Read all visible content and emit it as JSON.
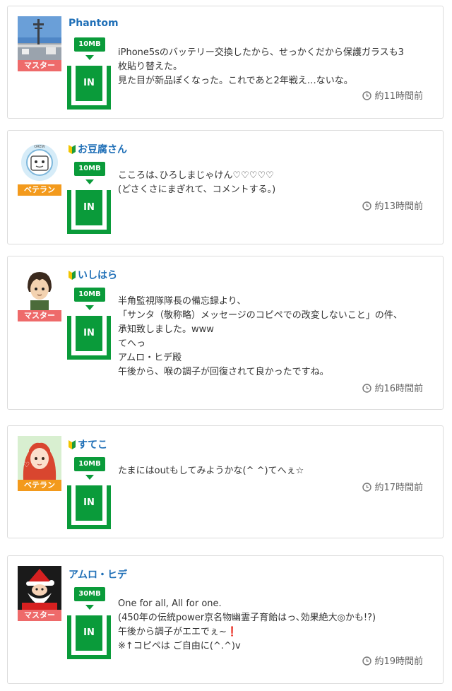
{
  "posts": [
    {
      "name": "Phantom",
      "rank": "マスター",
      "data_size": "10MB",
      "in_label": "IN",
      "lines": [
        "iPhone5sのバッテリー交換したから、せっかくだから保護ガラスも3",
        "枚貼り替えた。",
        "見た目が新品ぽくなった。これであと2年戦え…ないな。"
      ],
      "time": "約11時間前",
      "beginner": false
    },
    {
      "name": "お豆腐さん",
      "rank": "ベテラン",
      "data_size": "10MB",
      "in_label": "IN",
      "lines": [
        "こころは､ひろしまじゃけん♡♡♡♡♡",
        "(どさくさにまぎれて、コメントする｡)"
      ],
      "time": "約13時間前",
      "beginner": true
    },
    {
      "name": "いしはら",
      "rank": "マスター",
      "data_size": "10MB",
      "in_label": "IN",
      "lines": [
        "半角監視隊隊長の備忘録より、",
        "「サンタ（敬称略）メッセージのコピペでの改変しないこと」の件、",
        "承知致しました。www",
        "てへっ",
        "アムロ・ヒデ殿",
        "午後から、喉の調子が回復されて良かったですね。"
      ],
      "time": "約16時間前",
      "beginner": true
    },
    {
      "name": "すてこ",
      "rank": "ベテラン",
      "data_size": "10MB",
      "in_label": "IN",
      "lines": [
        "たまにはoutもしてみようかな(^ ^)てへぇ☆"
      ],
      "time": "約17時間前",
      "beginner": true
    },
    {
      "name": "アムロ・ヒデ",
      "rank": "マスター",
      "data_size": "30MB",
      "in_label": "IN",
      "lines": [
        "One for all, All for one.",
        "(450年の伝統power京名物幽霊子育飴はっ､効果絶大◎かも!?)",
        "午後から調子がエエでぇ~❗",
        "※↑コピペは ご自由に(^.^)v"
      ],
      "time": "約19時間前",
      "beginner": false
    }
  ],
  "colors": {
    "name": "#1f6fb7",
    "green": "#0a9b3a",
    "master": "#ee6a6a",
    "veteran": "#f39a1c"
  }
}
